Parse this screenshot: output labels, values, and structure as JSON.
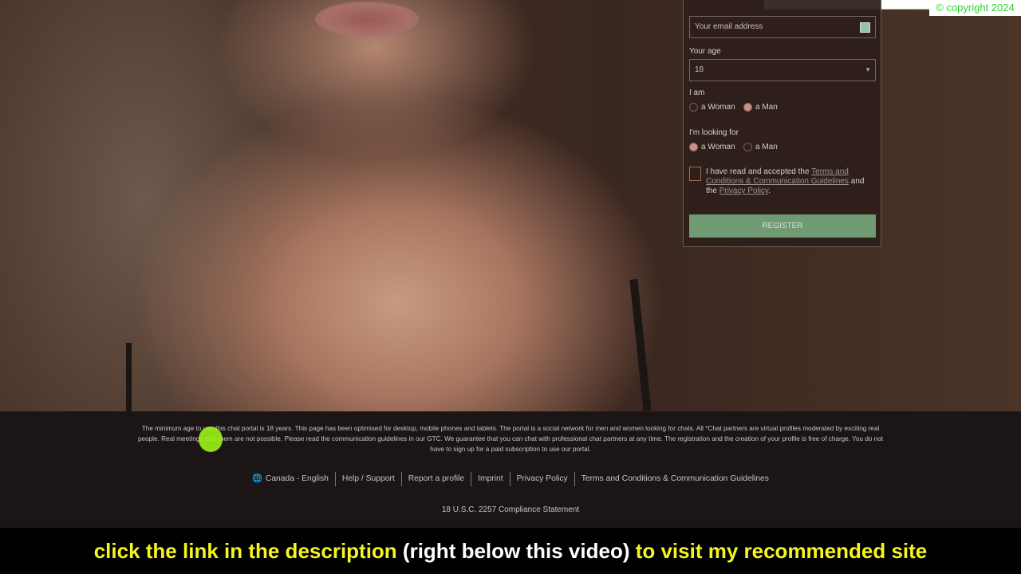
{
  "form": {
    "email_placeholder": "Your email address",
    "age_label": "Your age",
    "age_value": "18",
    "i_am_label": "I am",
    "i_am_options": [
      "a Woman",
      "a Man"
    ],
    "i_am_selected": "a Man",
    "looking_label": "I'm looking for",
    "looking_options": [
      "a Woman",
      "a Man"
    ],
    "looking_selected": "a Woman",
    "terms_pre": "I have read and accepted the ",
    "terms_link": "Terms and Conditions & Communication Guidelines",
    "terms_mid": " and the ",
    "privacy_link": "Privacy Policy",
    "terms_end": ".",
    "register": "REGISTER"
  },
  "copyright": "© copyright 2024",
  "footer": {
    "disclaimer": "The minimum age to use this chat portal is 18 years. This page has been optimised for desktop, mobile phones and tablets. The portal is a social network for men and women looking for chats. All *Chat partners are virtual profiles moderated by exciting real people. Real meetings with them are not possible. Please read the communication guidelines in our GTC. We guarantee that you can chat with professional chat partners at any time. The registration and the creation of your profile is free of charge. You do not have to sign up for a paid subscription to use our portal.",
    "links": [
      "Canada - English",
      "Help / Support",
      "Report a profile",
      "Imprint",
      "Privacy Policy",
      "Terms and Conditions & Communication Guidelines"
    ],
    "compliance": "18 U.S.C. 2257 Compliance Statement"
  },
  "banner": {
    "part1": "click the link in the description",
    "part2": " (right below this video) ",
    "part3": "to visit my recommended site"
  },
  "colors": {
    "register": "#6f9a72",
    "banner_yellow": "#f5f51f",
    "copyright_green": "#2fd32f"
  }
}
